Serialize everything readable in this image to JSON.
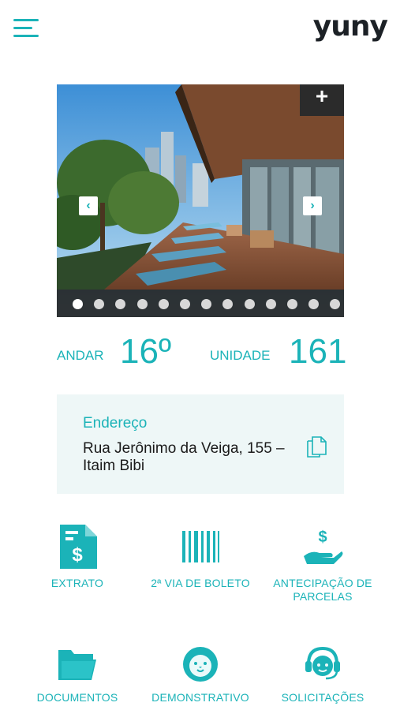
{
  "header": {
    "logo_text": "yuny",
    "menu_icon": "hamburger-menu-icon",
    "brand_color": "#1bb3b8"
  },
  "gallery": {
    "expand_label": "+",
    "prev_label": "‹",
    "next_label": "›",
    "dot_count": 13,
    "active_dot": 1
  },
  "unit_info": {
    "floor_label": "ANDAR",
    "floor_value": "16º",
    "unit_label": "UNIDADE",
    "unit_value": "161"
  },
  "address": {
    "title": "Endereço",
    "text": "Rua Jerônimo da Veiga, 155 – Itaim Bibi",
    "copy_icon": "copy-icon"
  },
  "actions": [
    {
      "label": "EXTRATO",
      "icon": "statement-icon"
    },
    {
      "label": "2ª VIA DE BOLETO",
      "icon": "barcode-icon"
    },
    {
      "label": "ANTECIPAÇÃO DE PARCELAS",
      "icon": "hand-money-icon"
    },
    {
      "label": "DOCUMENTOS",
      "icon": "folder-icon"
    },
    {
      "label": "DEMONSTRATIVO",
      "icon": "lion-icon"
    },
    {
      "label": "SOLICITAÇÕES",
      "icon": "headset-support-icon"
    }
  ]
}
